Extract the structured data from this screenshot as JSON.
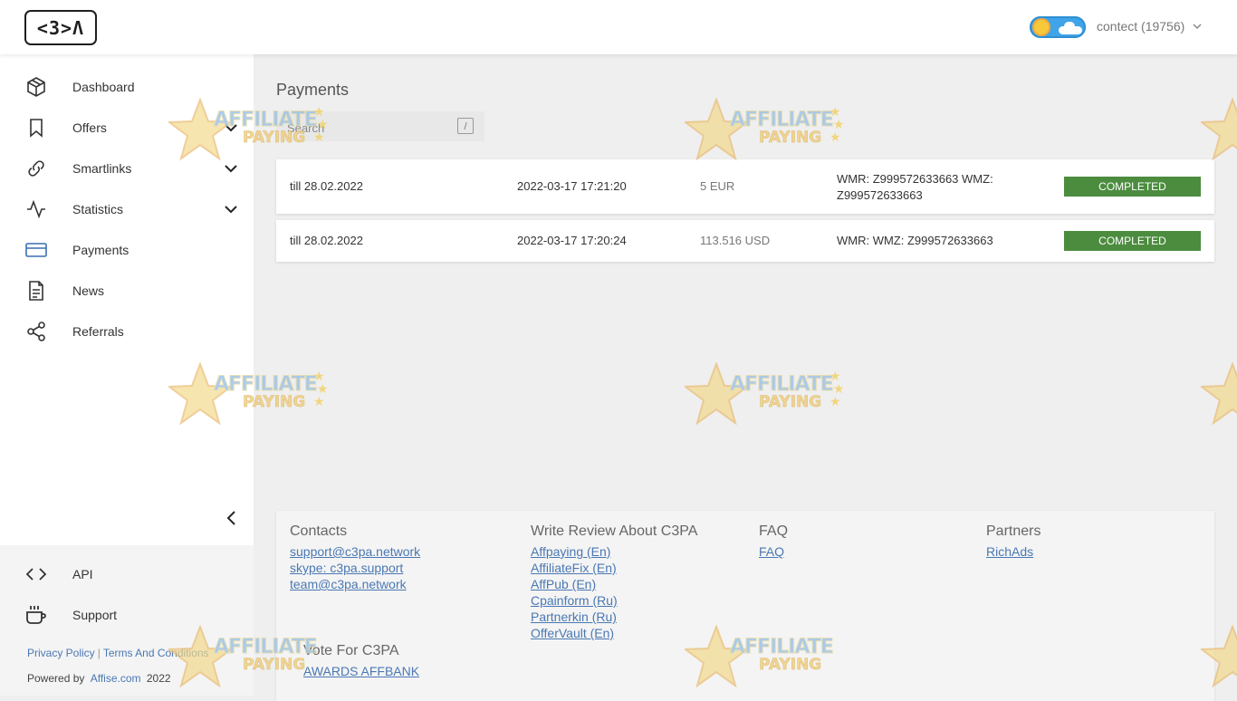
{
  "header": {
    "logo_text": "<3>Λ",
    "account_label": "contect (19756)"
  },
  "sidebar": {
    "items": [
      {
        "label": "Dashboard",
        "icon": "cube-icon"
      },
      {
        "label": "Offers",
        "icon": "bookmark-icon"
      },
      {
        "label": "Smartlinks",
        "icon": "link-icon"
      },
      {
        "label": "Statistics",
        "icon": "activity-icon"
      },
      {
        "label": "Payments",
        "icon": "credit-card-icon"
      },
      {
        "label": "News",
        "icon": "document-icon"
      },
      {
        "label": "Referrals",
        "icon": "share-icon"
      }
    ],
    "bottom_items": [
      {
        "label": "API",
        "icon": "code-icon"
      },
      {
        "label": "Support",
        "icon": "coffee-cup-icon"
      }
    ],
    "privacy_policy": "Privacy Policy",
    "terms": "Terms And Conditions",
    "powered_by": "Powered by",
    "powered_link": "Affise.com",
    "year": "2022"
  },
  "main": {
    "title": "Payments",
    "search": {
      "placeholder": "Search",
      "shortcut": "/"
    },
    "payments": [
      {
        "period": "till 28.02.2022",
        "datetime": "2022-03-17 17:21:20",
        "amount": "5 EUR",
        "wallet": "WMR: Z999572633663 WMZ: Z999572633663",
        "status": "COMPLETED"
      },
      {
        "period": "till 28.02.2022",
        "datetime": "2022-03-17 17:20:24",
        "amount": "113.516 USD",
        "wallet": "WMR: WMZ: Z999572633663",
        "status": "COMPLETED"
      }
    ]
  },
  "footer": {
    "contacts": {
      "title": "Contacts",
      "links": [
        "support@c3pa.network",
        "skype: c3pa.support",
        "team@c3pa.network"
      ]
    },
    "reviews": {
      "title": "Write Review About C3PA",
      "links": [
        "Affpaying (En)",
        "AffiliateFix (En)",
        "AffPub (En)",
        "Cpainform (Ru)",
        "Partnerkin (Ru)",
        "OfferVault (En)"
      ]
    },
    "faq": {
      "title": "FAQ",
      "links": [
        "FAQ"
      ]
    },
    "partners": {
      "title": "Partners",
      "links": [
        "RichAds"
      ]
    },
    "vote": {
      "title": "Vote For C3PA",
      "links": [
        "AWARDS AFFBANK"
      ]
    }
  },
  "watermark": {
    "line1": "AFFILIATE",
    "line2": "PAYING"
  },
  "colors": {
    "status_completed": "#4c8c3f",
    "link": "#4a78b3",
    "toggle": "#3fa4e8"
  }
}
